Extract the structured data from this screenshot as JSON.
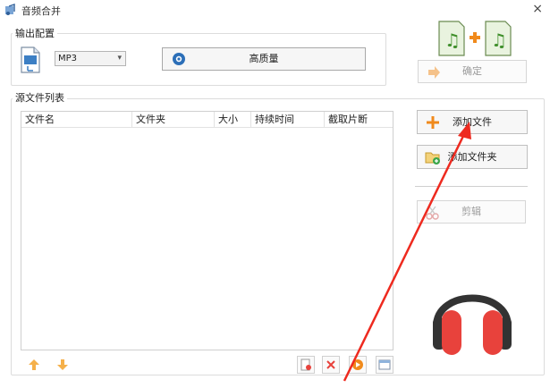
{
  "window": {
    "title": "音频合并",
    "close_glyph": "×"
  },
  "output_group": {
    "label": "输出配置",
    "format_value": "MP3",
    "quality_label": "高质量"
  },
  "actions": {
    "confirm_label": "确定",
    "add_file_label": "添加文件",
    "add_folder_label": "添加文件夹",
    "cut_label": "剪辑"
  },
  "source_group": {
    "label": "源文件列表",
    "columns": [
      "文件名",
      "文件夹",
      "大小",
      "持续时间",
      "截取片断"
    ]
  },
  "colors": {
    "accent_orange": "#f08a1c",
    "headphone_red": "#e8423c",
    "headphone_dark": "#333333",
    "arrow_red": "#ee2a1f"
  }
}
